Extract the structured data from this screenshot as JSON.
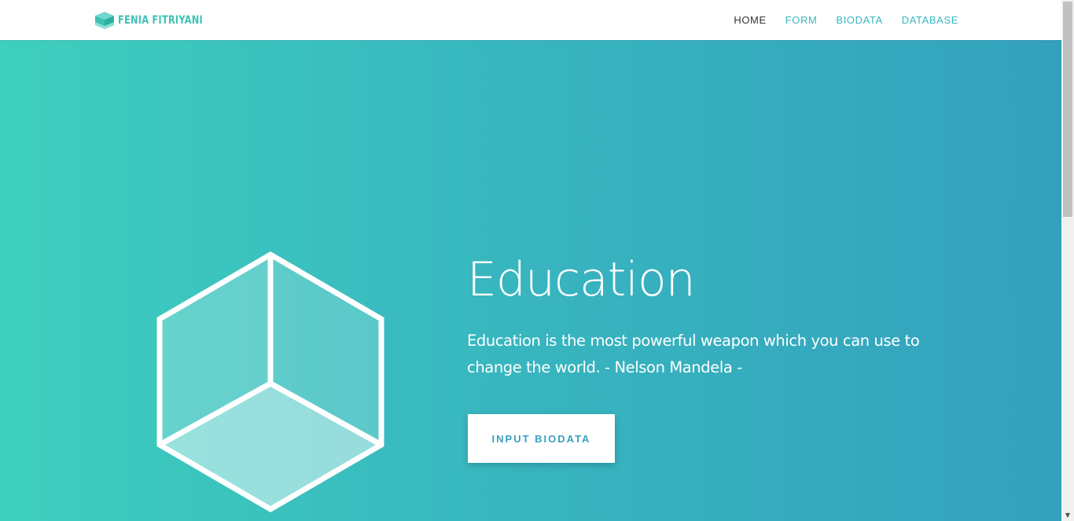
{
  "brand": {
    "name": "FENIA FITRIYANI",
    "logo_icon": "cube-icon"
  },
  "nav": {
    "items": [
      {
        "label": "HOME",
        "active": true
      },
      {
        "label": "FORM",
        "active": false
      },
      {
        "label": "BIODATA",
        "active": false
      },
      {
        "label": "DATABASE",
        "active": false
      }
    ]
  },
  "hero": {
    "title": "Education",
    "quote": "Education is the most powerful weapon which you can use to change the world. - Nelson Mandela -",
    "button_label": "INPUT BIODATA",
    "illustration_icon": "cube-outline-icon"
  },
  "colors": {
    "accent": "#3fc1b5",
    "gradient_start": "#3ecfbe",
    "gradient_end": "#33a1bd",
    "button_text": "#3a9fbf"
  }
}
